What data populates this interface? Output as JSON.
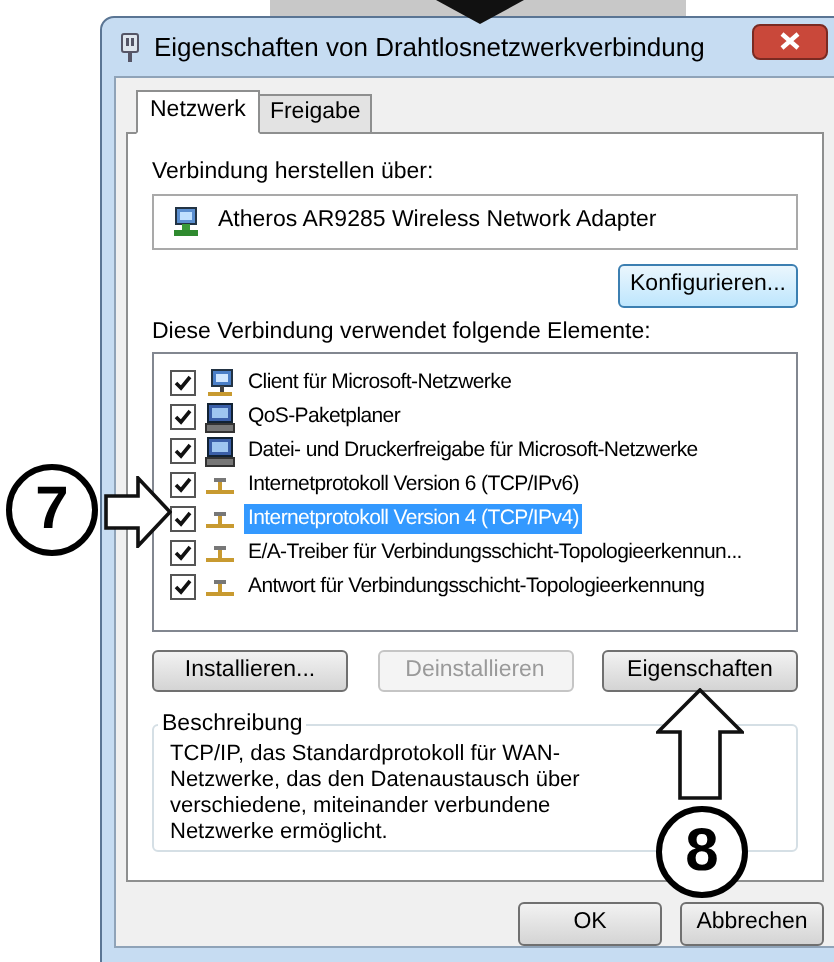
{
  "window": {
    "title": "Eigenschaften von Drahtlosnetzwerkverbindung"
  },
  "tabs": [
    {
      "label": "Netzwerk",
      "selected": true
    },
    {
      "label": "Freigabe",
      "selected": false
    }
  ],
  "connect_label": "Verbindung herstellen über:",
  "adapter": "Atheros AR9285 Wireless Network Adapter",
  "configure_button": "Konfigurieren...",
  "elements_label": "Diese Verbindung verwendet folgende Elemente:",
  "elements": [
    {
      "kind": "client",
      "label": "Client für Microsoft-Netzwerke",
      "checked": true,
      "selected": false
    },
    {
      "kind": "service",
      "label": "QoS-Paketplaner",
      "checked": true,
      "selected": false
    },
    {
      "kind": "service",
      "label": "Datei- und Druckerfreigabe für Microsoft-Netzwerke",
      "checked": true,
      "selected": false
    },
    {
      "kind": "protocol",
      "label": "Internetprotokoll Version 6 (TCP/IPv6)",
      "checked": true,
      "selected": false
    },
    {
      "kind": "protocol",
      "label": "Internetprotokoll Version 4 (TCP/IPv4)",
      "checked": true,
      "selected": true
    },
    {
      "kind": "protocol",
      "label": "E/A-Treiber für Verbindungsschicht-Topologieerkennun...",
      "checked": true,
      "selected": false
    },
    {
      "kind": "protocol",
      "label": "Antwort für Verbindungsschicht-Topologieerkennung",
      "checked": true,
      "selected": false
    }
  ],
  "action_buttons": [
    {
      "label": "Installieren...",
      "disabled": false
    },
    {
      "label": "Deinstallieren",
      "disabled": true
    },
    {
      "label": "Eigenschaften",
      "disabled": false
    }
  ],
  "description": {
    "title": "Beschreibung",
    "text": "TCP/IP, das Standardprotokoll für WAN-Netzwerke, das den Datenaustausch über verschiedene, miteinander verbundene Netzwerke ermöglicht."
  },
  "dialog_buttons": [
    "OK",
    "Abbrechen"
  ],
  "annotations": [
    {
      "label": "7"
    },
    {
      "label": "8"
    }
  ]
}
